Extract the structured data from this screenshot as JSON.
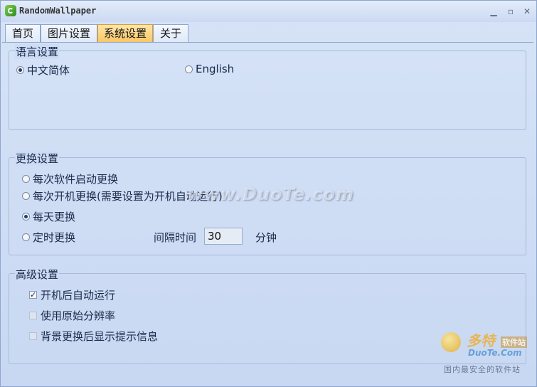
{
  "window": {
    "title": "RandomWallpaper"
  },
  "tabs": [
    {
      "label": "首页"
    },
    {
      "label": "图片设置"
    },
    {
      "label": "系统设置"
    },
    {
      "label": "关于"
    }
  ],
  "language": {
    "title": "语言设置",
    "options": [
      {
        "label": "中文简体",
        "selected": true
      },
      {
        "label": "English",
        "selected": false
      }
    ]
  },
  "change": {
    "title": "更换设置",
    "options": [
      {
        "label": "每次软件启动更换",
        "selected": false
      },
      {
        "label": "每次开机更换(需要设置为开机自动运行)",
        "selected": false
      },
      {
        "label": "每天更换",
        "selected": true
      },
      {
        "label": "定时更换",
        "selected": false
      }
    ],
    "interval_label": "间隔时间",
    "interval_value": "30",
    "interval_unit": "分钟"
  },
  "advanced": {
    "title": "高级设置",
    "options": [
      {
        "label": "开机后自动运行",
        "checked": true
      },
      {
        "label": "使用原始分辨率",
        "checked": false
      },
      {
        "label": "背景更换后显示提示信息",
        "checked": false
      }
    ]
  },
  "watermark": {
    "url": "www.DuoTe.com",
    "logo_cn": "多特",
    "logo_badge": "软件站",
    "logo_en": "DuoTe.Com",
    "logo_slogan": "国内最安全的软件站"
  }
}
